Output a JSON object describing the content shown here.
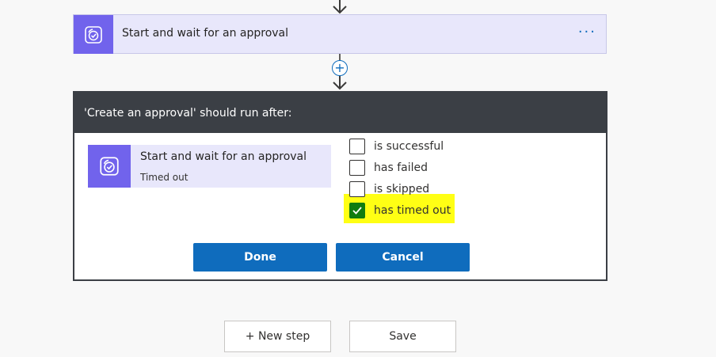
{
  "flow": {
    "action_card": {
      "title": "Start and wait for an approval",
      "more_label": "···",
      "icon": "approval-icon"
    },
    "insert_label": "+"
  },
  "dialog": {
    "header": "'Create an approval' should run after:",
    "source": {
      "name": "Start and wait for an approval",
      "status": "Timed out",
      "icon": "approval-icon"
    },
    "options": [
      {
        "label": "is successful",
        "checked": false
      },
      {
        "label": "has failed",
        "checked": false
      },
      {
        "label": "is skipped",
        "checked": false
      },
      {
        "label": "has timed out",
        "checked": true
      }
    ],
    "done_label": "Done",
    "cancel_label": "Cancel"
  },
  "footer": {
    "new_step_label": "+ New step",
    "save_label": "Save"
  },
  "colors": {
    "accent": "#0f6cbd",
    "approval_purple": "#7163ec",
    "card_bg": "#e8e7fb",
    "dialog_header": "#3b3f45",
    "checked_green": "#107c10",
    "highlight": "#ffff00"
  }
}
